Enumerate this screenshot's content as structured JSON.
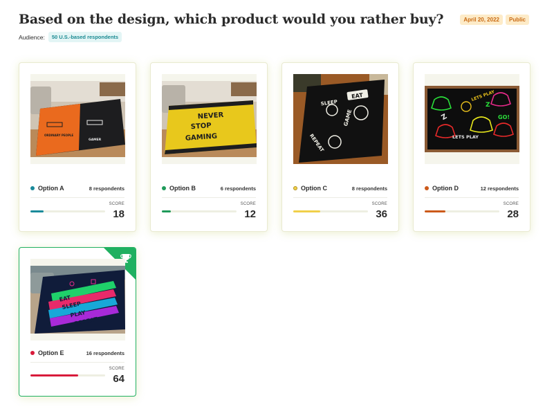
{
  "header": {
    "title": "Based on the design, which product would you rather buy?",
    "date": "April 20, 2022",
    "visibility": "Public",
    "audience_label": "Audience:",
    "audience_value": "50 U.S.-based respondents"
  },
  "score_label": "SCORE",
  "options": [
    {
      "name": "Option A",
      "respondents": "8 respondents",
      "score": "18",
      "fraction": 0.18,
      "color": "#1a8a9a",
      "image": "orange-black-gamer-rug",
      "image_text": [
        "ORDINARY PEOPLE",
        "GAMER"
      ]
    },
    {
      "name": "Option B",
      "respondents": "6 respondents",
      "score": "12",
      "fraction": 0.12,
      "color": "#1f9a5a",
      "image": "never-stop-gaming-rug",
      "image_text": [
        "NEVER",
        "STOP",
        "GAMING"
      ]
    },
    {
      "name": "Option C",
      "respondents": "8 respondents",
      "score": "36",
      "fraction": 0.36,
      "color": "#f0d04a",
      "image": "eat-sleep-game-repeat-rug",
      "image_text": [
        "EAT",
        "SLEEP",
        "GAME",
        "REPEAT"
      ]
    },
    {
      "name": "Option D",
      "respondents": "12 respondents",
      "score": "28",
      "fraction": 0.28,
      "color": "#cc5a1a",
      "image": "neon-controller-rug",
      "image_text": [
        "LETS PLAY",
        "GO!",
        "LETS PLAY"
      ]
    },
    {
      "name": "Option E",
      "respondents": "16 respondents",
      "score": "64",
      "fraction": 0.64,
      "color": "#d81a3a",
      "image": "eat-sleep-play-repeat-rug",
      "image_text": [
        "EAT",
        "SLEEP",
        "PLAY",
        "REPEAT"
      ],
      "winner": true
    }
  ],
  "icons": {
    "winner": "trophy-icon"
  },
  "colors": {
    "winner_ribbon": "#20b060",
    "badge_text": "#c96a12",
    "badge_bg": "#fdebc8"
  }
}
